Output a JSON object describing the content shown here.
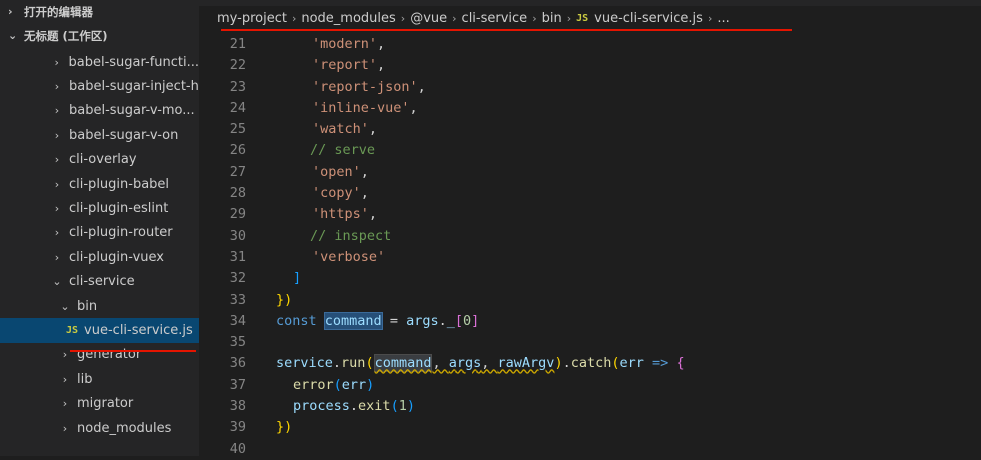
{
  "sidebar": {
    "open_editors": "打开的编辑器",
    "workspace": "无标题 (工作区)",
    "items": [
      {
        "label": "babel-sugar-functi...",
        "depth": 1,
        "chev": "›"
      },
      {
        "label": "babel-sugar-inject-h",
        "depth": 1,
        "chev": "›"
      },
      {
        "label": "babel-sugar-v-mo...",
        "depth": 1,
        "chev": "›"
      },
      {
        "label": "babel-sugar-v-on",
        "depth": 1,
        "chev": "›"
      },
      {
        "label": "cli-overlay",
        "depth": 1,
        "chev": "›"
      },
      {
        "label": "cli-plugin-babel",
        "depth": 1,
        "chev": "›"
      },
      {
        "label": "cli-plugin-eslint",
        "depth": 1,
        "chev": "›"
      },
      {
        "label": "cli-plugin-router",
        "depth": 1,
        "chev": "›"
      },
      {
        "label": "cli-plugin-vuex",
        "depth": 1,
        "chev": "›"
      },
      {
        "label": "cli-service",
        "depth": 1,
        "chev": "⌄"
      },
      {
        "label": "bin",
        "depth": 2,
        "chev": "⌄"
      },
      {
        "label": "vue-cli-service.js",
        "depth": 3,
        "chev": "",
        "file": "JS",
        "selected": true
      },
      {
        "label": "generator",
        "depth": 2,
        "chev": "›"
      },
      {
        "label": "lib",
        "depth": 2,
        "chev": "›"
      },
      {
        "label": "migrator",
        "depth": 2,
        "chev": "›"
      },
      {
        "label": "node_modules",
        "depth": 2,
        "chev": "›"
      }
    ]
  },
  "breadcrumb": {
    "parts": [
      "my-project",
      "node_modules",
      "@vue",
      "cli-service",
      "bin"
    ],
    "file_icon": "JS",
    "file": "vue-cli-service.js",
    "tail": "..."
  },
  "code": {
    "lines": [
      {
        "n": "21",
        "t": "'modern',"
      },
      {
        "n": "22",
        "t": "'report',"
      },
      {
        "n": "23",
        "t": "'report-json',"
      },
      {
        "n": "24",
        "t": "'inline-vue',"
      },
      {
        "n": "25",
        "t": "'watch',"
      },
      {
        "n": "26",
        "t": "// serve"
      },
      {
        "n": "27",
        "t": "'open',"
      },
      {
        "n": "28",
        "t": "'copy',"
      },
      {
        "n": "29",
        "t": "'https',"
      },
      {
        "n": "30",
        "t": "// inspect"
      },
      {
        "n": "31",
        "t": "'verbose'"
      },
      {
        "n": "32",
        "t": "]"
      },
      {
        "n": "33",
        "t": "})"
      },
      {
        "n": "34",
        "t": "const command = args._[0]"
      },
      {
        "n": "35",
        "t": ""
      },
      {
        "n": "36",
        "t": "service.run(command, args, rawArgv).catch(err => {"
      },
      {
        "n": "37",
        "t": "error(err)"
      },
      {
        "n": "38",
        "t": "process.exit(1)"
      },
      {
        "n": "39",
        "t": "})"
      },
      {
        "n": "40",
        "t": ""
      }
    ]
  }
}
